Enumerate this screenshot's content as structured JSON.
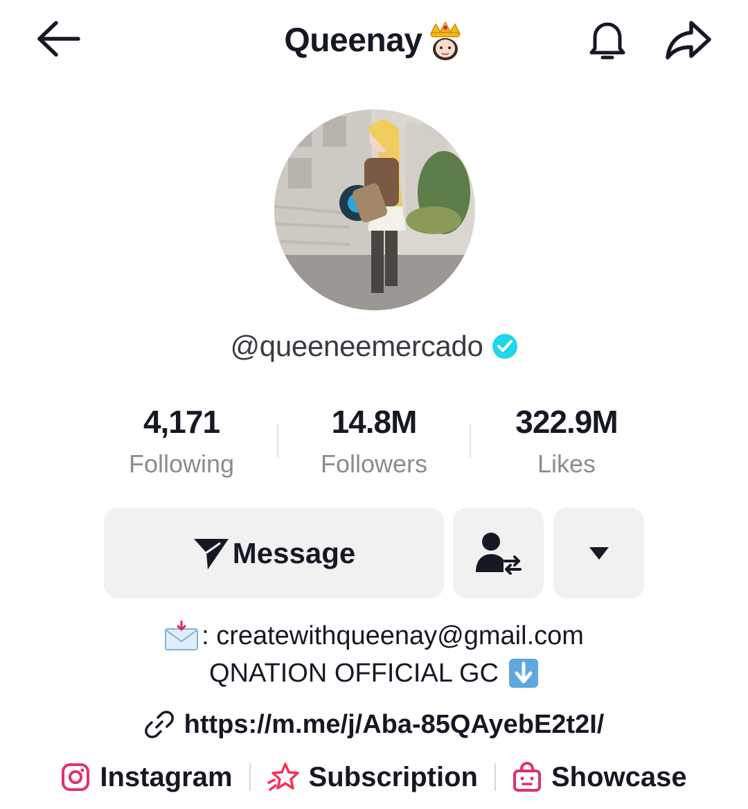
{
  "header": {
    "title": "Queenay",
    "icons": [
      "back-arrow-icon",
      "crown-emoji",
      "bell-icon",
      "share-icon"
    ]
  },
  "profile": {
    "username": "@queeneemercado",
    "verified": true
  },
  "stats": [
    {
      "value": "4,171",
      "label": "Following"
    },
    {
      "value": "14.8M",
      "label": "Followers"
    },
    {
      "value": "322.9M",
      "label": "Likes"
    }
  ],
  "actions": {
    "message_label": "Message",
    "icons": [
      "send-icon",
      "follow-back-icon",
      "dropdown-icon"
    ]
  },
  "bio": {
    "line1": ": createwithqueenay@gmail.com",
    "line2": "QNATION OFFICIAL GC"
  },
  "link": "https://m.me/j/Aba-85QAyebE2t2I/",
  "bottom_links": [
    {
      "label": "Instagram",
      "icon": "instagram-icon"
    },
    {
      "label": "Subscription",
      "icon": "subscription-star-icon"
    },
    {
      "label": "Showcase",
      "icon": "shopping-bag-icon"
    }
  ],
  "colors": {
    "text": "#161823",
    "muted": "#8a8b91",
    "button_bg": "#f1f1f2",
    "verified": "#20d5ec",
    "instagram": "#e1306c",
    "subscription": "#fe2c55",
    "showcase": "#e1306c"
  }
}
